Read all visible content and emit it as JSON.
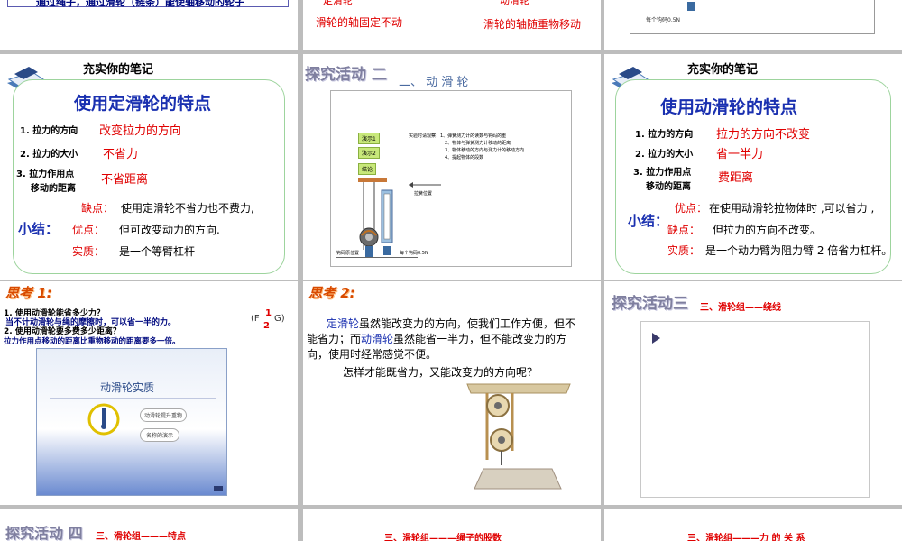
{
  "row0": {
    "s1_text": "通过绳子，通过滑轮（链条）能使轴移动的轮子",
    "s2_fixed": "定滑轮",
    "s2_fixed_desc": "滑轮的轴固定不动",
    "s2_moving": "动滑轮",
    "s2_moving_desc": "滑轮的轴随重物移动",
    "s3_caption": "每个钩码0.5N"
  },
  "slide_fixed": {
    "header": "充实你的笔记",
    "title": "使用定滑轮的特点",
    "items": [
      {
        "label": "1.  拉力的方向",
        "value": "改变拉力的方向"
      },
      {
        "label": "2.  拉力的大小",
        "value": "不省力"
      },
      {
        "label": "3.  拉力作用点",
        "label2": "移动的距离",
        "value": "不省距离"
      }
    ],
    "summary": "小结：",
    "rows": [
      {
        "key": "缺点：",
        "text": "使用定滑轮不省力也不费力,"
      },
      {
        "key": "优点：",
        "text": "但可改变动力的方向."
      },
      {
        "key": "实质：",
        "text": "是一个等臂杠杆"
      }
    ]
  },
  "slide_activity2": {
    "title": "探究活动 二",
    "subtitle": "二、    动    滑    轮",
    "buttons": [
      "演示1",
      "演示2",
      "结论"
    ],
    "instructions": [
      "实验时请观察：1、弹簧测力计的读数与钩码的重",
      "2、物体与弹簧测力计移动的距离",
      "3、物体移动的方向与测力计的移动方向",
      "4、提起物体的段数"
    ],
    "label_pull": "拉簧位置",
    "label_hook": "钩码原位置",
    "label_each": "每个钩码0.5N"
  },
  "slide_moving": {
    "header": "充实你的笔记",
    "title": "使用动滑轮的特点",
    "items": [
      {
        "label": "1.  拉力的方向",
        "value": "拉力的方向不改变"
      },
      {
        "label": "2.  拉力的大小",
        "value": "省一半力"
      },
      {
        "label": "3.  拉力作用点",
        "label2": "移动的距离",
        "value": "费距离"
      }
    ],
    "summary": "小结：",
    "rows": [
      {
        "key": "优点：",
        "text": "在使用动滑轮拉物体时 ,可以省力 ,"
      },
      {
        "key": "缺点：",
        "text": "但拉力的方向不改变。"
      },
      {
        "key": "实质：",
        "text": "是一个动力臂为阻力臂 2 倍省力杠杆。"
      }
    ]
  },
  "slide_think1": {
    "badge": "思考 1:",
    "q1": "1. 使用动滑轮能省多少力？",
    "a1": "当不计动滑轮与绳的摩擦时，可以省一半的力。",
    "formula_left": "(F",
    "formula_num": "1",
    "formula_den": "2",
    "formula_right": "G)",
    "q2": "2. 使用动滑轮要多费多少距离？",
    "a2": "拉力作用点移动的距离比重物移动的距离要多一倍。",
    "video_title": "动滑轮实质",
    "btn1": "动滑轮提升重物",
    "btn2": "名称的演示"
  },
  "slide_think2": {
    "badge": "思考 2:",
    "p1_a": "定滑轮",
    "p1_b": "虽然能改变力的方向，使我们工作方便，但不",
    "p1_c": "能省力；而",
    "p1_d": "动滑轮",
    "p1_e": "虽然能省一半力，但不能改变力的方",
    "p1_f": "向，使用时经常感觉不便。",
    "p2": "怎样才能既省力，又能改变力的方向呢？"
  },
  "slide_activity3": {
    "title": "探究活动三",
    "subtitle": "三、滑轮组——绕线"
  },
  "row_bottom": {
    "s1_title": "探究活动 四",
    "s1_sub": "三、滑轮组———特点",
    "s2_sub": "三、滑轮组———绳子的股数",
    "s3_sub": "三、滑轮组———力 的 关 系"
  },
  "colors": {
    "red": "#e00000",
    "blue": "#1a30b0",
    "navy": "#000a80",
    "frame": "#bdbdbd"
  }
}
